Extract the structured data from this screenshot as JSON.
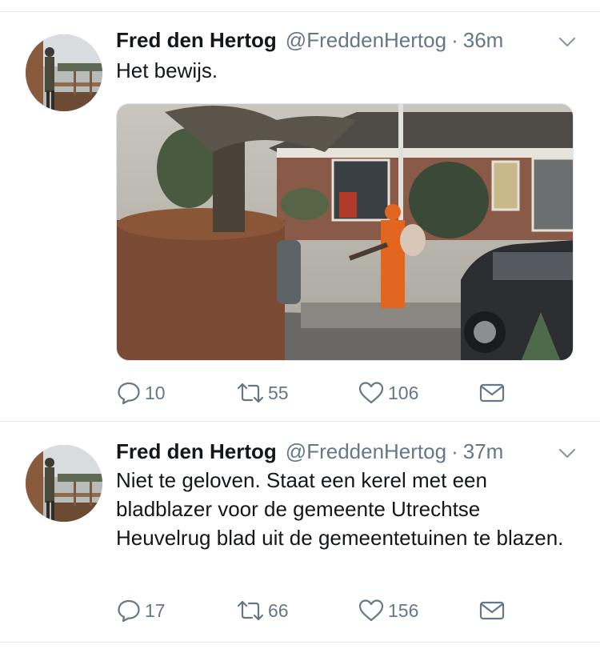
{
  "tweets": [
    {
      "author_name": "Fred den Hertog",
      "handle": "@FreddenHertog",
      "separator": "·",
      "time": "36m",
      "text": "Het bewijs.",
      "has_media": true,
      "replies": "10",
      "retweets": "55",
      "likes": "106"
    },
    {
      "author_name": "Fred den Hertog",
      "handle": "@FreddenHertog",
      "separator": "·",
      "time": "37m",
      "text": "Niet te geloven. Staat een kerel met een bladblazer voor de gemeente Utrechtse Heuvelrug blad uit de gemeentetuinen te blazen.",
      "has_media": false,
      "replies": "17",
      "retweets": "66",
      "likes": "156"
    }
  ],
  "colors": {
    "text": "#14171a",
    "secondary": "#657786",
    "divider": "#e1e8ed"
  },
  "icons": [
    "reply-icon",
    "retweet-icon",
    "like-icon",
    "direct-message-icon",
    "chevron-down-icon"
  ]
}
